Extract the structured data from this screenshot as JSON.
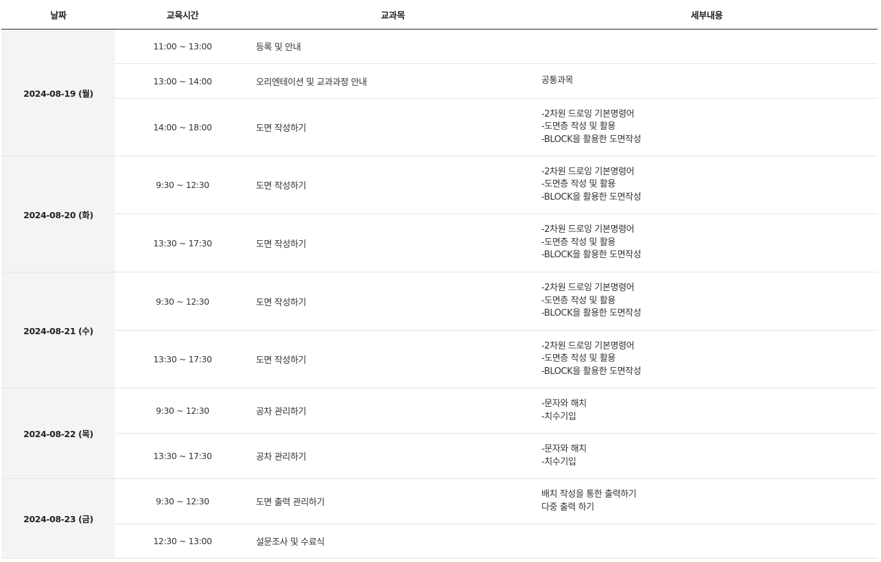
{
  "headers": {
    "date": "날짜",
    "time": "교육시간",
    "subject": "교과목",
    "details": "세부내용"
  },
  "days": [
    {
      "date": "2024-08-19 (월)",
      "sessions": [
        {
          "time": "11:00 ~ 13:00",
          "subject": "등록 및 안내",
          "details": []
        },
        {
          "time": "13:00 ~ 14:00",
          "subject": "오리엔테이션 및 교과과정 안내",
          "details": [
            "공통과목"
          ]
        },
        {
          "time": "14:00 ~ 18:00",
          "subject": "도면 작성하기",
          "details": [
            "-2차원 드로잉 기본명령어",
            "-도면층 작성 및 활용",
            "-BLOCK을 활용한 도면작성"
          ]
        }
      ]
    },
    {
      "date": "2024-08-20 (화)",
      "sessions": [
        {
          "time": "9:30 ~ 12:30",
          "subject": "도면 작성하기",
          "details": [
            "-2차원 드로잉 기본명령어",
            "-도면층 작성 및 활용",
            "-BLOCK을 활용한 도면작성"
          ]
        },
        {
          "time": "13:30 ~ 17:30",
          "subject": "도면 작성하기",
          "details": [
            "-2차원 드로잉 기본명령어",
            "-도면층 작성 및 활용",
            "-BLOCK을 활용한 도면작성"
          ]
        }
      ]
    },
    {
      "date": "2024-08-21 (수)",
      "sessions": [
        {
          "time": "9:30 ~ 12:30",
          "subject": "도면 작성하기",
          "details": [
            "-2차원 드로잉 기본명령어",
            "-도면층 작성 및 활용",
            "-BLOCK을 활용한 도면작성"
          ]
        },
        {
          "time": "13:30 ~ 17:30",
          "subject": "도면 작성하기",
          "details": [
            "-2차원 드로잉 기본명령어",
            "-도면층 작성 및 활용",
            "-BLOCK을 활용한 도면작성"
          ]
        }
      ]
    },
    {
      "date": "2024-08-22 (목)",
      "sessions": [
        {
          "time": "9:30 ~ 12:30",
          "subject": "공차 관리하기",
          "details": [
            "-문자와 해치",
            "-치수기입"
          ]
        },
        {
          "time": "13:30 ~ 17:30",
          "subject": "공차 관리하기",
          "details": [
            "-문자와 해치",
            "-치수기입"
          ]
        }
      ]
    },
    {
      "date": "2024-08-23 (금)",
      "sessions": [
        {
          "time": "9:30 ~ 12:30",
          "subject": "도면 출력 관리하기",
          "details": [
            "배치 작성을 통한 출력하기",
            "다중 출력 하기"
          ]
        },
        {
          "time": "12:30 ~ 13:00",
          "subject": "설문조사 및 수료식",
          "details": []
        }
      ]
    }
  ],
  "colors": {
    "date_bg": "#f3f4f6",
    "header_rule": "#222222",
    "row_rule": "#e4e4e4"
  }
}
